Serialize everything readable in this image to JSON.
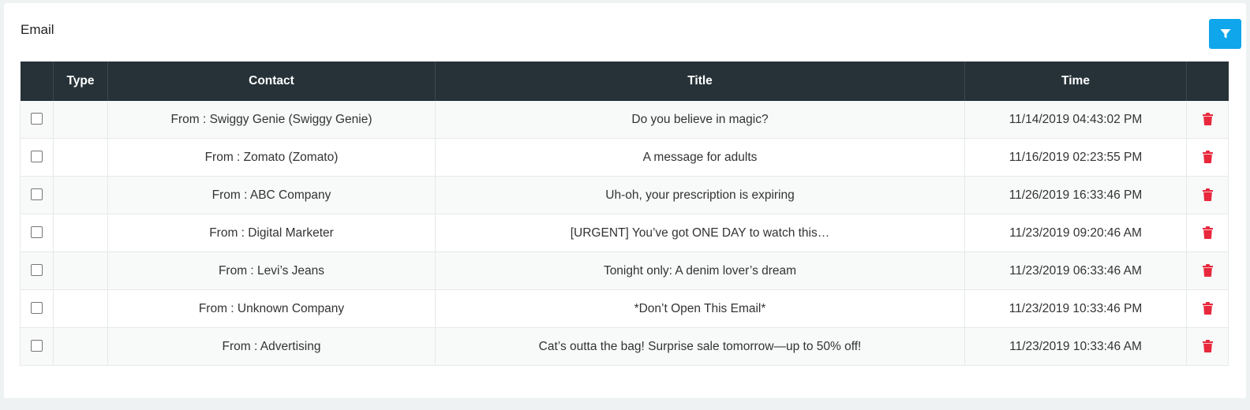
{
  "card": {
    "title": "Email"
  },
  "table": {
    "headers": {
      "select": "",
      "type": "Type",
      "contact": "Contact",
      "title": "Title",
      "time": "Time",
      "action": ""
    },
    "rows": [
      {
        "type": "",
        "contact": "From : Swiggy Genie (Swiggy Genie)",
        "title": "Do you believe in magic?",
        "time": "11/14/2019 04:43:02 PM"
      },
      {
        "type": "",
        "contact": "From : Zomato (Zomato)",
        "title": "A message for adults",
        "time": "11/16/2019 02:23:55 PM"
      },
      {
        "type": "",
        "contact": "From : ABC Company",
        "title": "Uh-oh, your prescription is expiring",
        "time": "11/26/2019 16:33:46 PM"
      },
      {
        "type": "",
        "contact": "From : Digital Marketer",
        "title": "[URGENT] You’ve got ONE DAY to watch this…",
        "time": "11/23/2019 09:20:46 AM"
      },
      {
        "type": "",
        "contact": "From : Levi’s Jeans",
        "title": "Tonight only: A denim lover’s dream",
        "time": "11/23/2019 06:33:46 AM"
      },
      {
        "type": "",
        "contact": "From : Unknown Company",
        "title": "*Don’t Open This Email*",
        "time": "11/23/2019 10:33:46 PM"
      },
      {
        "type": "",
        "contact": "From : Advertising",
        "title": "Cat’s outta the bag! Surprise sale tomorrow—up to 50% off!",
        "time": "11/23/2019 10:33:46 AM"
      }
    ]
  },
  "icons": {
    "filter": "filter-icon",
    "delete": "trash-icon"
  },
  "colors": {
    "header_bg": "#263238",
    "accent": "#0fa6ec",
    "delete": "#e8283c"
  }
}
